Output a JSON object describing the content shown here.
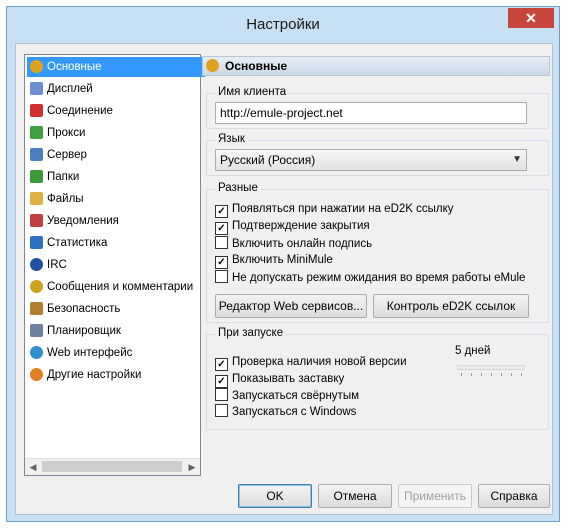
{
  "window": {
    "title": "Настройки",
    "close_glyph": "✕"
  },
  "sidebar": {
    "items": [
      {
        "label": "Основные",
        "icon": "gear-icon",
        "color": "#e0a020",
        "selected": true
      },
      {
        "label": "Дисплей",
        "icon": "display-icon",
        "color": "#6a8fd0"
      },
      {
        "label": "Соединение",
        "icon": "connection-icon",
        "color": "#d03030"
      },
      {
        "label": "Прокси",
        "icon": "proxy-icon",
        "color": "#40a040"
      },
      {
        "label": "Сервер",
        "icon": "server-icon",
        "color": "#4a80c0"
      },
      {
        "label": "Папки",
        "icon": "folder-icon",
        "color": "#3a9a3a"
      },
      {
        "label": "Файлы",
        "icon": "files-icon",
        "color": "#e0b040"
      },
      {
        "label": "Уведомления",
        "icon": "notification-icon",
        "color": "#c04040"
      },
      {
        "label": "Статистика",
        "icon": "statistics-icon",
        "color": "#3070c0"
      },
      {
        "label": "IRC",
        "icon": "irc-icon",
        "color": "#2050a0"
      },
      {
        "label": "Сообщения и комментарии",
        "icon": "messages-icon",
        "color": "#d0a020"
      },
      {
        "label": "Безопасность",
        "icon": "lock-icon",
        "color": "#b08030"
      },
      {
        "label": "Планировщик",
        "icon": "scheduler-icon",
        "color": "#7080a0"
      },
      {
        "label": "Web интерфейс",
        "icon": "web-icon",
        "color": "#3090d0"
      },
      {
        "label": "Другие настройки",
        "icon": "settings-icon",
        "color": "#e08020"
      }
    ]
  },
  "panel": {
    "title": "Основные",
    "client_name": {
      "label": "Имя клиента",
      "value": "http://emule-project.net"
    },
    "language": {
      "label": "Язык",
      "selected": "Русский (Россия)"
    },
    "misc": {
      "label": "Разные",
      "options": [
        {
          "label": "Появляться при нажатии на eD2K ссылку",
          "checked": true
        },
        {
          "label": "Подтверждение закрытия",
          "checked": true
        },
        {
          "label": "Включить онлайн подпись",
          "checked": false
        },
        {
          "label": "Включить MiniMule",
          "checked": true
        },
        {
          "label": "Не допускать режим ожидания во время работы eMule",
          "checked": false
        }
      ],
      "web_services_button": "Редактор Web сервисов...",
      "ed2k_button": "Контроль eD2K ссылок"
    },
    "startup": {
      "label": "При запуске",
      "options": [
        {
          "label": "Проверка наличия новой версии",
          "checked": true
        },
        {
          "label": "Показывать заставку",
          "checked": true
        },
        {
          "label": "Запускаться свёрнутым",
          "checked": false
        },
        {
          "label": "Запускаться с Windows",
          "checked": false
        }
      ],
      "update_interval": "5 дней"
    }
  },
  "footer": {
    "ok": "OK",
    "cancel": "Отмена",
    "apply": "Применить",
    "help": "Справка"
  }
}
